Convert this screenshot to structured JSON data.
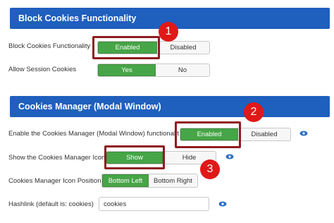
{
  "sections": {
    "block_cookies": {
      "title": "Block Cookies Functionality"
    },
    "cookies_manager": {
      "title": "Cookies Manager (Modal Window)"
    }
  },
  "rows": {
    "block_cookies": {
      "label": "Block Cookies Functionality",
      "options": [
        "Enabled",
        "Disabled"
      ],
      "selected": "Enabled"
    },
    "session_cookies": {
      "label": "Allow Session Cookies",
      "options": [
        "Yes",
        "No"
      ],
      "selected": "Yes"
    },
    "enable_manager": {
      "label": "Enable the Cookies Manager (Modal Window) functionalit",
      "options": [
        "Enabled",
        "Disabled"
      ],
      "selected": "Enabled"
    },
    "show_icon": {
      "label": "Show the Cookies Manager Icon",
      "options": [
        "Show",
        "Hide"
      ],
      "selected": "Show"
    },
    "icon_position": {
      "label": "Cookies Manager Icon Position",
      "options": [
        "Bottom Left",
        "Bottom Right"
      ],
      "selected": "Bottom Left"
    },
    "hashlink": {
      "label": "Hashlink (default is: cookies)",
      "value": "cookies"
    }
  },
  "callouts": [
    "1",
    "2",
    "3"
  ],
  "icons": {
    "preview": "eye-icon"
  },
  "colors": {
    "header_bg": "#1f5fbd",
    "active_green": "#46a546",
    "callout_red": "#e01818",
    "highlight_border": "#8f1c22",
    "eye_blue": "#2f6fc4"
  }
}
